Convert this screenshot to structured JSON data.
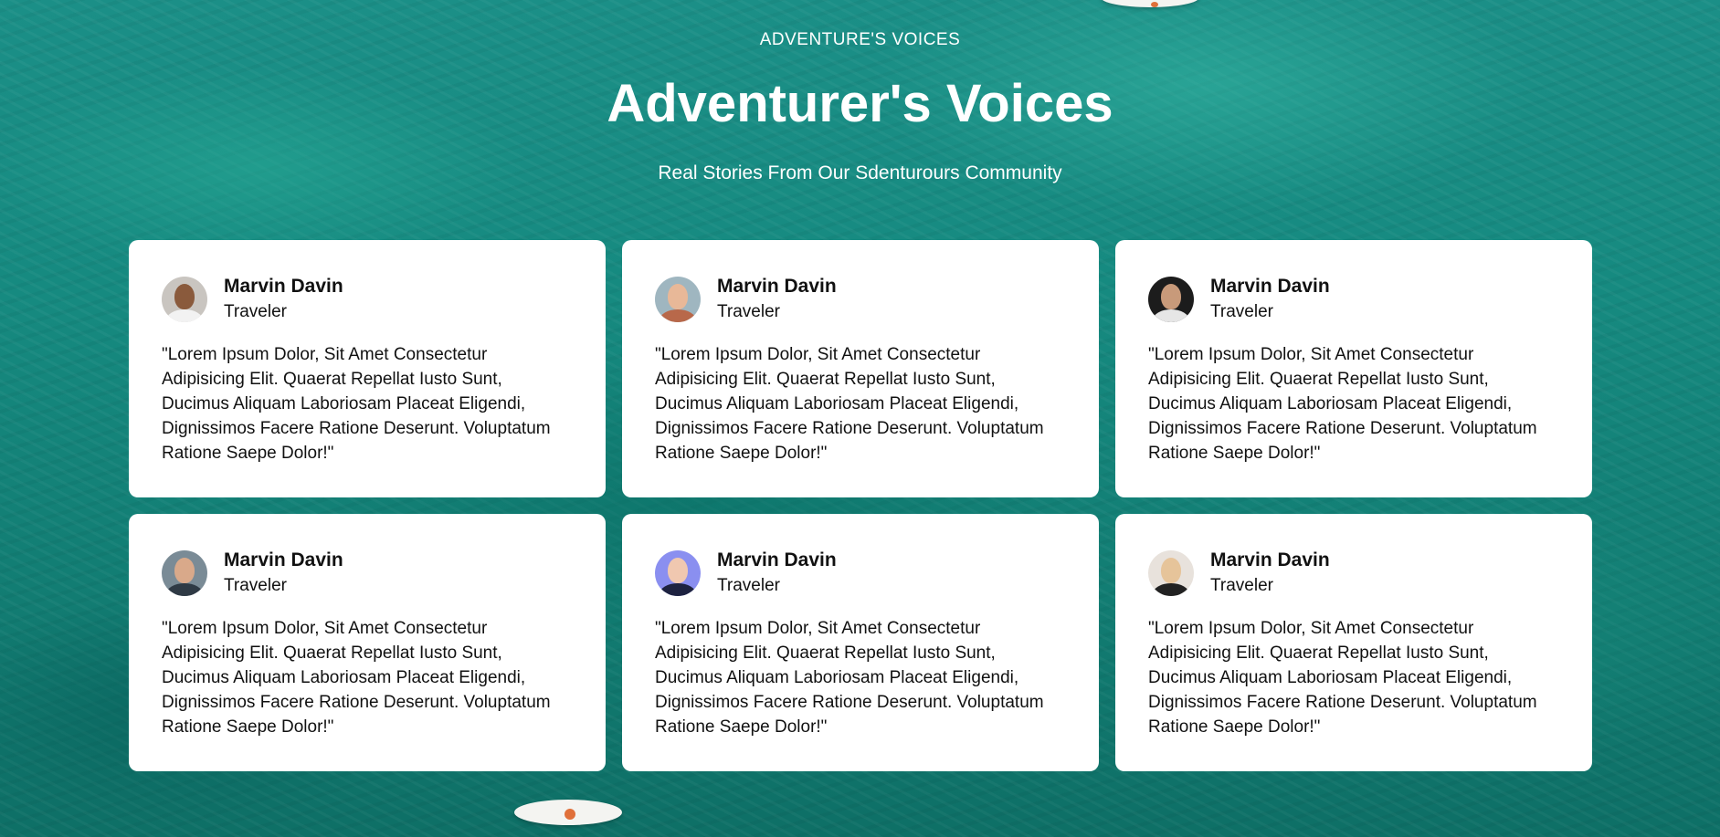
{
  "header": {
    "eyebrow": "ADVENTURE'S VOICES",
    "title": "Adventurer's Voices",
    "subtitle": "Real Stories From Our Sdenturours Community"
  },
  "testimonials": [
    {
      "name": "Marvin Davin",
      "role": "Traveler",
      "quote": "\"Lorem Ipsum Dolor, Sit Amet Consectetur Adipisicing Elit. Quaerat Repellat Iusto Sunt, Ducimus Aliquam Laboriosam Placeat Eligendi, Dignissimos Facere Ratione Deserunt. Voluptatum Ratione Saepe Dolor!\"",
      "avatar_bg": "#c9c5c0",
      "avatar_face": "#8a5a3c",
      "avatar_body": "#f2f2f2"
    },
    {
      "name": "Marvin Davin",
      "role": "Traveler",
      "quote": "\"Lorem Ipsum Dolor, Sit Amet Consectetur Adipisicing Elit. Quaerat Repellat Iusto Sunt, Ducimus Aliquam Laboriosam Placeat Eligendi, Dignissimos Facere Ratione Deserunt. Voluptatum Ratione Saepe Dolor!\"",
      "avatar_bg": "#9fb6c0",
      "avatar_face": "#e8b898",
      "avatar_body": "#b8684a"
    },
    {
      "name": "Marvin Davin",
      "role": "Traveler",
      "quote": "\"Lorem Ipsum Dolor, Sit Amet Consectetur Adipisicing Elit. Quaerat Repellat Iusto Sunt, Ducimus Aliquam Laboriosam Placeat Eligendi, Dignissimos Facere Ratione Deserunt. Voluptatum Ratione Saepe Dolor!\"",
      "avatar_bg": "#1c1c1c",
      "avatar_face": "#c89a7a",
      "avatar_body": "#e6e6e6"
    },
    {
      "name": "Marvin Davin",
      "role": "Traveler",
      "quote": "\"Lorem Ipsum Dolor, Sit Amet Consectetur Adipisicing Elit. Quaerat Repellat Iusto Sunt, Ducimus Aliquam Laboriosam Placeat Eligendi, Dignissimos Facere Ratione Deserunt. Voluptatum Ratione Saepe Dolor!\"",
      "avatar_bg": "#7a8b96",
      "avatar_face": "#d9a98a",
      "avatar_body": "#2f3a45"
    },
    {
      "name": "Marvin Davin",
      "role": "Traveler",
      "quote": "\"Lorem Ipsum Dolor, Sit Amet Consectetur Adipisicing Elit. Quaerat Repellat Iusto Sunt, Ducimus Aliquam Laboriosam Placeat Eligendi, Dignissimos Facere Ratione Deserunt. Voluptatum Ratione Saepe Dolor!\"",
      "avatar_bg": "#8a8ff0",
      "avatar_face": "#f0c8b0",
      "avatar_body": "#1d2240"
    },
    {
      "name": "Marvin Davin",
      "role": "Traveler",
      "quote": "\"Lorem Ipsum Dolor, Sit Amet Consectetur Adipisicing Elit. Quaerat Repellat Iusto Sunt, Ducimus Aliquam Laboriosam Placeat Eligendi, Dignissimos Facere Ratione Deserunt. Voluptatum Ratione Saepe Dolor!\"",
      "avatar_bg": "#e8e2dc",
      "avatar_face": "#e6c49a",
      "avatar_body": "#222222"
    }
  ]
}
